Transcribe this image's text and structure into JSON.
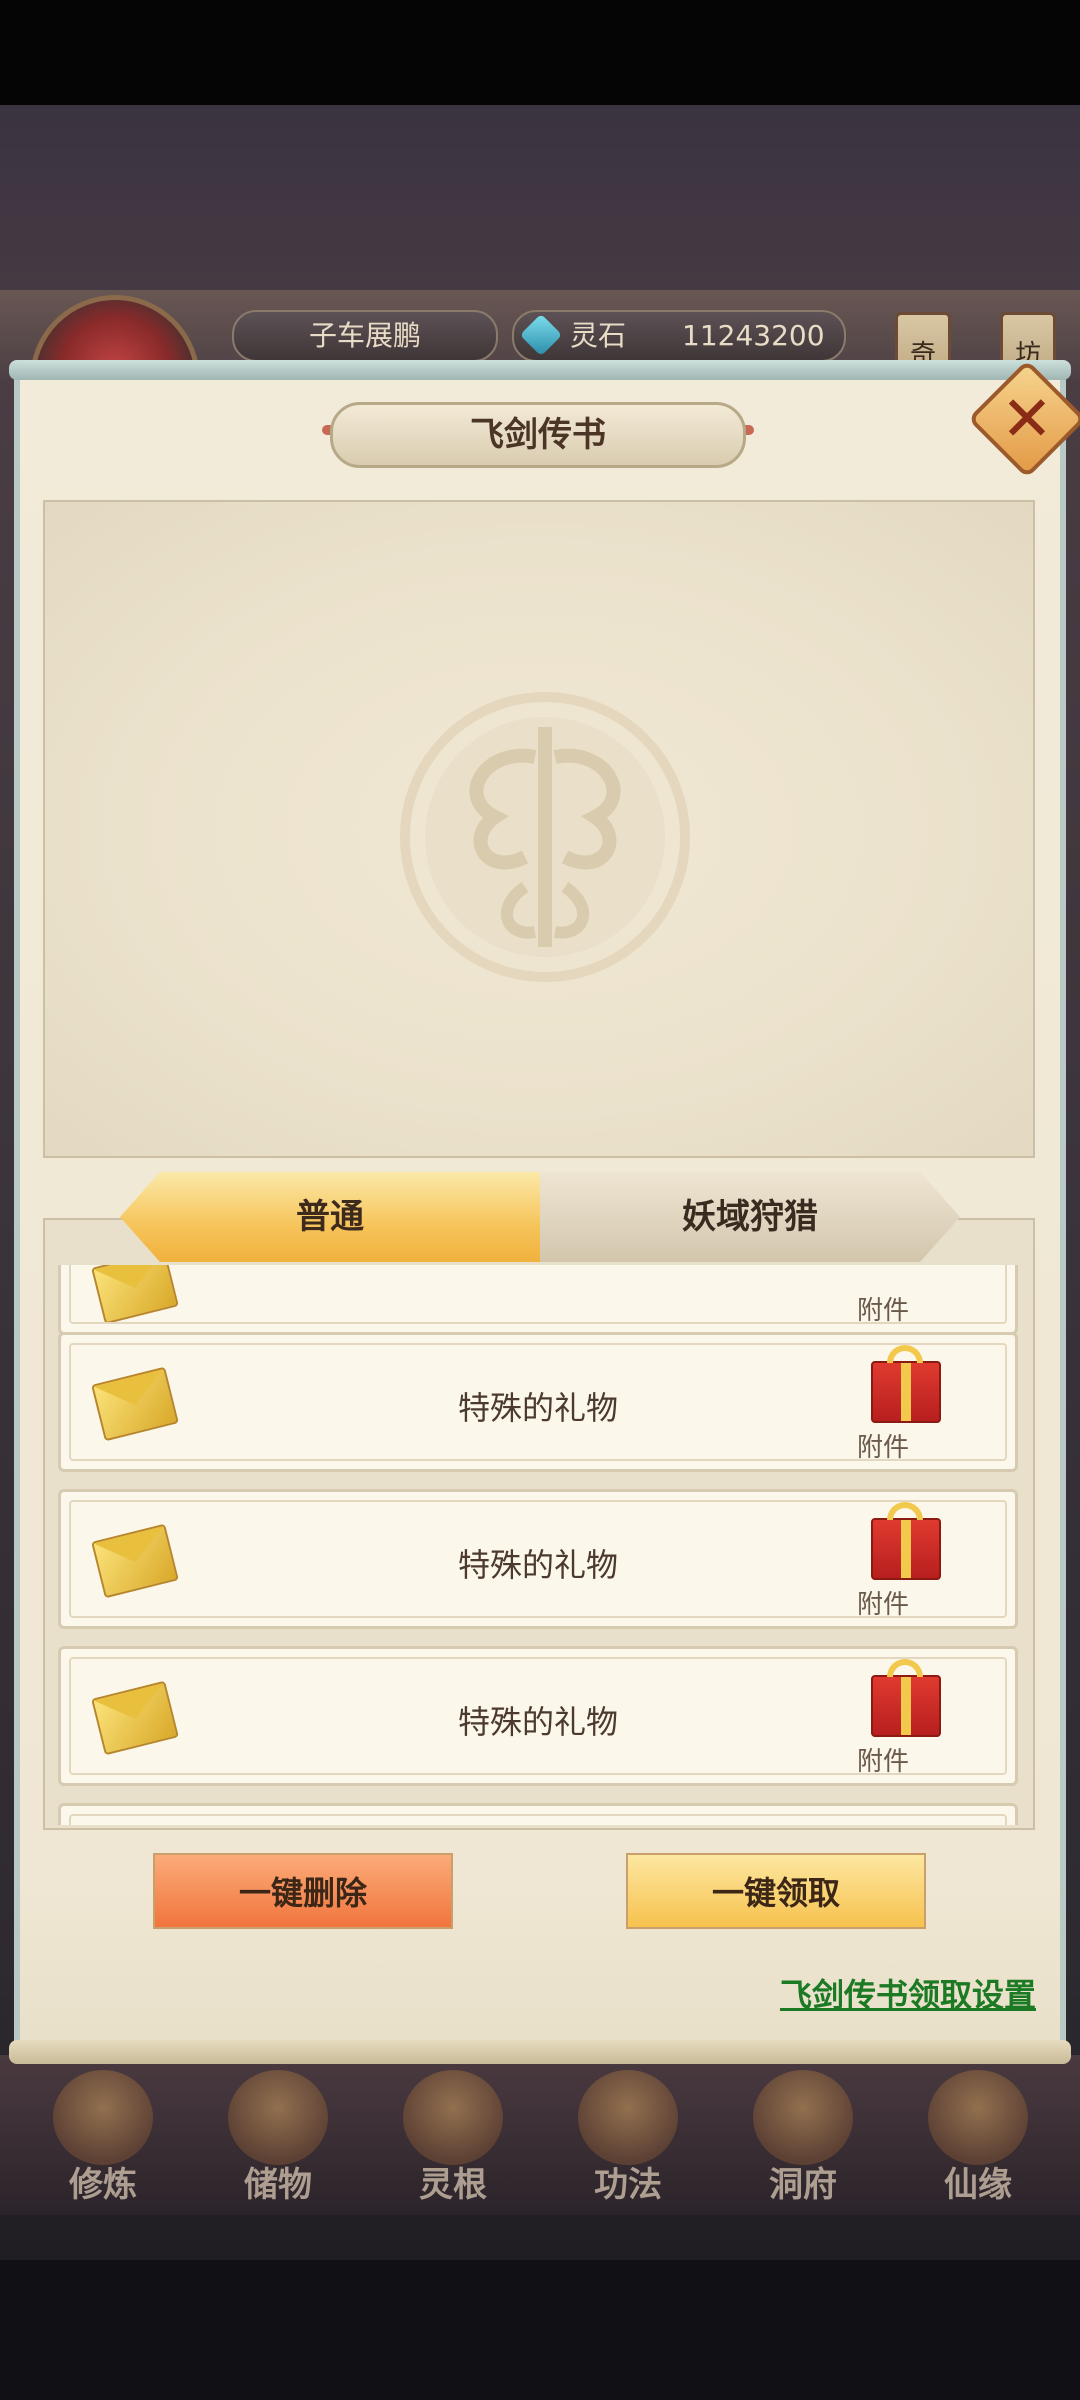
{
  "hud": {
    "player_name": "子车展鹏",
    "currency_label": "灵石",
    "currency_value": "11243200",
    "side_tags": [
      "奇",
      "坊"
    ]
  },
  "dialog": {
    "title": "飞剑传书",
    "close_label": "✕",
    "tabs": [
      {
        "label": "普通",
        "active": true
      },
      {
        "label": "妖域狩猎",
        "active": false
      }
    ],
    "mail_items": [
      {
        "title": "",
        "attachment_label": "附件"
      },
      {
        "title": "特殊的礼物",
        "attachment_label": "附件"
      },
      {
        "title": "特殊的礼物",
        "attachment_label": "附件"
      },
      {
        "title": "特殊的礼物",
        "attachment_label": "附件"
      }
    ],
    "delete_all_label": "一键删除",
    "claim_all_label": "一键领取",
    "settings_link": "飞剑传书领取设置"
  },
  "bottom_nav": [
    {
      "label": "修炼",
      "icon": "meditation-icon"
    },
    {
      "label": "储物",
      "icon": "bag-icon"
    },
    {
      "label": "灵根",
      "icon": "orb-icon"
    },
    {
      "label": "功法",
      "icon": "book-icon"
    },
    {
      "label": "洞府",
      "icon": "house-icon"
    },
    {
      "label": "仙缘",
      "icon": "gourd-icon"
    }
  ],
  "colors": {
    "accent_gold": "#f6c24e",
    "delete_orange": "#f1753d",
    "link_green": "#1c7a24"
  }
}
